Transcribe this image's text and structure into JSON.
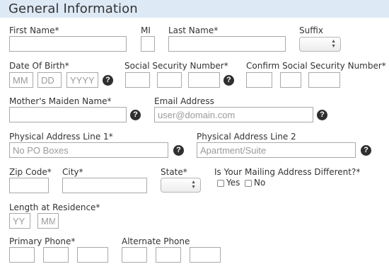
{
  "header": {
    "title": "General Information"
  },
  "labels": {
    "first_name": "First Name*",
    "mi": "MI",
    "last_name": "Last Name*",
    "suffix": "Suffix",
    "dob": "Date Of Birth*",
    "ssn": "Social Security Number*",
    "confirm_ssn": "Confirm Social Security Number*",
    "maiden": "Mother's Maiden Name*",
    "email": "Email Address",
    "addr1": "Physical Address Line 1*",
    "addr2": "Physical Address Line 2",
    "zip": "Zip Code*",
    "city": "City*",
    "state": "State*",
    "mailing": "Is Your Mailing Address Different?*",
    "yes": "Yes",
    "no": "No",
    "residence": "Length at Residence*",
    "primary_phone": "Primary Phone*",
    "alt_phone": "Alternate Phone"
  },
  "placeholders": {
    "dob_mm": "MM",
    "dob_dd": "DD",
    "dob_yyyy": "YYYY",
    "email": "user@domain.com",
    "addr1": "No PO Boxes",
    "addr2": "Apartment/Suite",
    "res_yy": "YY",
    "res_mm": "MM"
  },
  "icons": {
    "help": "?"
  }
}
